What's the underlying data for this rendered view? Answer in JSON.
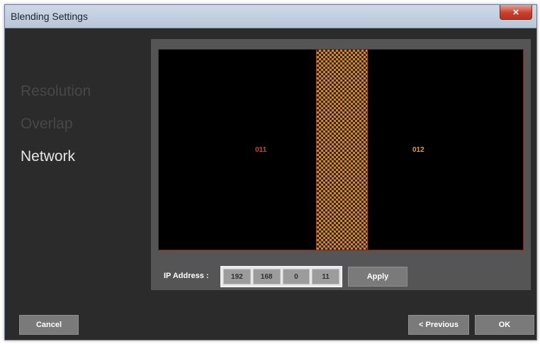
{
  "window": {
    "title": "Blending Settings",
    "close_glyph": "×"
  },
  "nav": {
    "items": [
      {
        "label": "Resolution",
        "state": "inactive"
      },
      {
        "label": "Overlap",
        "state": "inactive"
      },
      {
        "label": "Network",
        "state": "active"
      }
    ]
  },
  "preview": {
    "screen1_label": "011",
    "screen2_label": "012",
    "colors": {
      "screen1_label": "#d2432b",
      "screen2_label": "#d9a23f",
      "overlap_pattern": "#c88a3a"
    }
  },
  "network": {
    "ip_label": "IP Address :",
    "ip_octets": [
      "192",
      "168",
      "0",
      "11"
    ],
    "apply_label": "Apply"
  },
  "footer": {
    "cancel_label": "Cancel",
    "previous_label": "< Previous",
    "ok_label": "OK"
  }
}
